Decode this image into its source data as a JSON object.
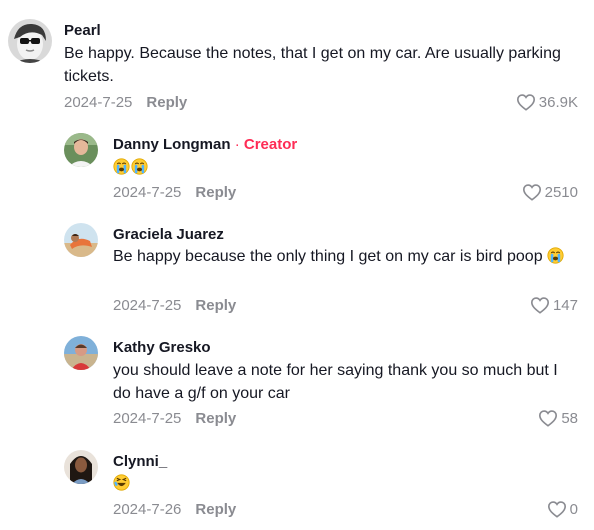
{
  "comments": [
    {
      "name": "Pearl",
      "text": "Be happy. Because the notes, that I get on my car. Are usually parking tickets.",
      "date": "2024-7-25",
      "reply_label": "Reply",
      "likes": "36.9K"
    },
    {
      "name": "Danny Longman",
      "creator_label": "Creator",
      "separator": "·",
      "emojis": [
        "crying-emoji",
        "crying-emoji"
      ],
      "date": "2024-7-25",
      "reply_label": "Reply",
      "likes": "2510"
    },
    {
      "name": "Graciela Juarez",
      "text": "Be happy because the only thing I get on my car is bird poop",
      "emojis": [
        "crying-emoji"
      ],
      "date": "2024-7-25",
      "reply_label": "Reply",
      "likes": "147"
    },
    {
      "name": "Kathy Gresko",
      "text": "you should leave a note for her saying thank you so much but I do have a g/f on your car",
      "date": "2024-7-25",
      "reply_label": "Reply",
      "likes": "58"
    },
    {
      "name": "Clynni_",
      "emojis": [
        "laughing-emoji"
      ],
      "date": "2024-7-26",
      "reply_label": "Reply",
      "likes": "0"
    }
  ],
  "colors": {
    "creator": "#fe2c55",
    "muted": "#8a8b91",
    "text": "#161823"
  }
}
